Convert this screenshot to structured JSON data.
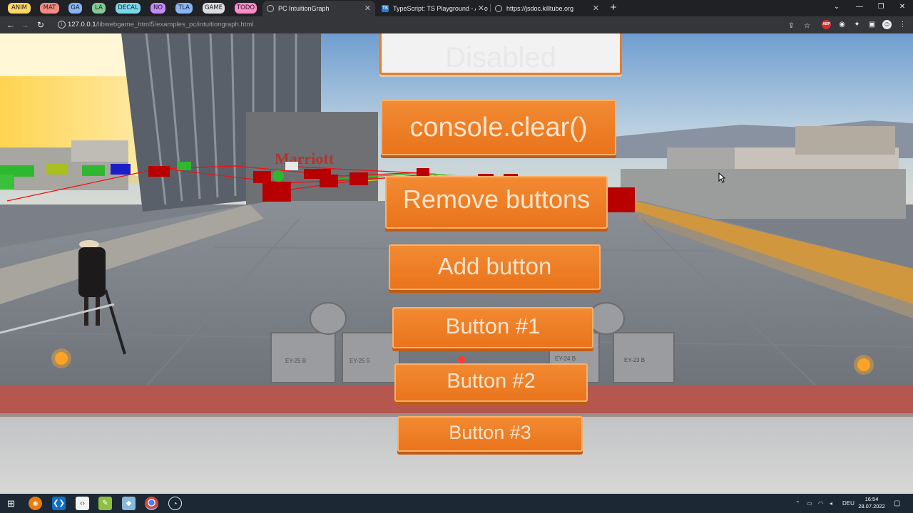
{
  "tab_groups": [
    {
      "label": "ANIM",
      "color": "#fdd663"
    },
    {
      "label": "MAT",
      "color": "#f28b82"
    },
    {
      "label": "GA",
      "color": "#8ab4f8"
    },
    {
      "label": "LA",
      "color": "#81c995"
    },
    {
      "label": "DECAL",
      "color": "#78d9ec"
    },
    {
      "label": "NO",
      "color": "#c58af9"
    },
    {
      "label": "TLA",
      "color": "#8ab4f8"
    },
    {
      "label": "GAME",
      "color": "#dadce0"
    },
    {
      "label": "TODO",
      "color": "#ff8bcb"
    }
  ],
  "tabs": [
    {
      "title": "PC IntuitionGraph",
      "icon": "globe-icon"
    },
    {
      "title": "TypeScript: TS Playground - An o",
      "icon": "ts-icon"
    },
    {
      "title": "https://jsdoc.killtube.org",
      "icon": "globe-icon"
    }
  ],
  "address_bar": {
    "host": "127.0.0.1",
    "path": "/libwebgame_html5/examples_pc/intuitiongraph.html"
  },
  "toolbar_icons": {
    "adblock_label": "ABP"
  },
  "ui_buttons": {
    "disabled_label": "Disabled",
    "console_clear_label": "console.clear()",
    "remove_buttons_label": "Remove buttons",
    "add_button_label": "Add button",
    "button1_label": "Button #1",
    "button2_label": "Button #2",
    "button3_label": "Button #3"
  },
  "scene_labels": {
    "hotel_sign": "Marriott",
    "unit_labels": [
      "EY-25 B",
      "EY-25 5",
      "EY-24 B",
      "EY-23 B"
    ]
  },
  "colors": {
    "button_orange": "#ee7a22",
    "graph_red": "#b80000",
    "graph_green": "#2fb82f",
    "graph_blue": "#1e1ec8"
  },
  "taskbar": {
    "language": "DEU",
    "time": "16:54",
    "date": "28.07.2022"
  }
}
